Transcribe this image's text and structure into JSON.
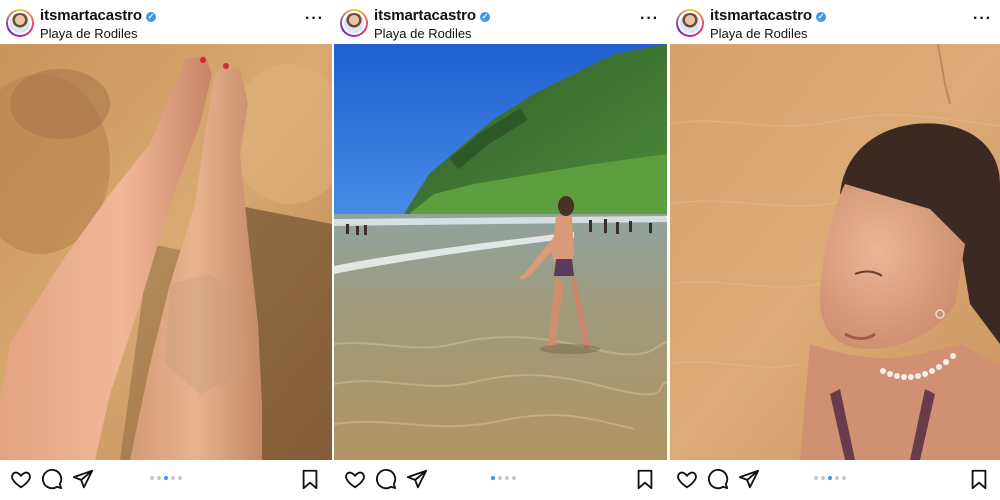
{
  "posts": [
    {
      "username": "itsmartacastro",
      "location": "Playa de Rodiles",
      "carousel": {
        "count": 5,
        "active_index": 2
      }
    },
    {
      "username": "itsmartacastro",
      "location": "Playa de Rodiles",
      "carousel": {
        "count": 4,
        "active_index": 0
      }
    },
    {
      "username": "itsmartacastro",
      "location": "Playa de Rodiles",
      "carousel": {
        "count": 5,
        "active_index": 2
      }
    }
  ],
  "icons": {
    "verified": "verified-badge-icon",
    "more": "more-options-icon",
    "like": "heart-icon",
    "comment": "comment-icon",
    "share": "send-icon",
    "save": "bookmark-icon"
  },
  "colors": {
    "accent": "#3897f0",
    "inactive_dot": "#c7c7c7",
    "text": "#111111"
  }
}
